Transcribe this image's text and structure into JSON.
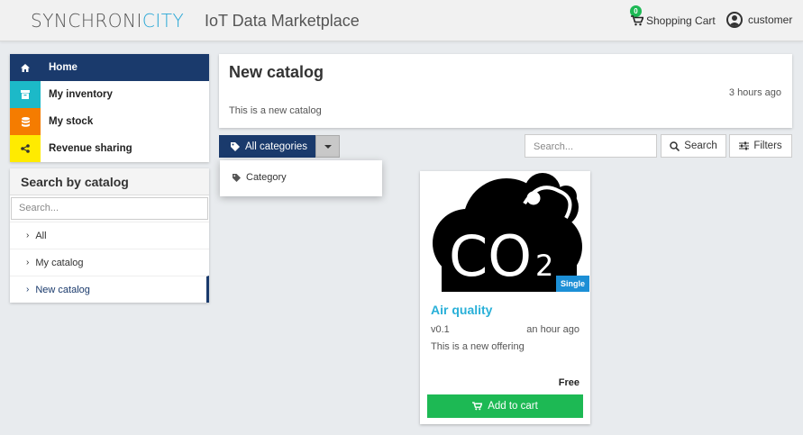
{
  "header": {
    "logo_part1": "SYNCHRONI",
    "logo_part2": "CITY",
    "app_title": "IoT Data Marketplace",
    "cart_badge": "0",
    "cart_label": "Shopping Cart",
    "user_label": "customer"
  },
  "nav": {
    "items": [
      {
        "label": "Home",
        "icon": "home-icon",
        "color": "#1a3a6c"
      },
      {
        "label": "My inventory",
        "icon": "archive-icon",
        "color": "#1cb9c8"
      },
      {
        "label": "My stock",
        "icon": "database-icon",
        "color": "#f57c00"
      },
      {
        "label": "Revenue sharing",
        "icon": "share-icon",
        "color": "#ffeb00"
      }
    ]
  },
  "catalog_search": {
    "title": "Search by catalog",
    "placeholder": "Search...",
    "items": [
      "All",
      "My catalog",
      "New catalog"
    ]
  },
  "catalog_panel": {
    "title": "New catalog",
    "time": "3 hours ago",
    "description": "This is a new catalog"
  },
  "toolbar": {
    "categories_label": "All categories",
    "dropdown_item": "Category",
    "search_placeholder": "Search...",
    "search_label": "Search",
    "filters_label": "Filters"
  },
  "offering": {
    "image_text": "CO",
    "image_subscript": "2",
    "badge": "Single",
    "title": "Air quality",
    "version": "v0.1",
    "time": "an hour ago",
    "description": "This is a new offering",
    "price": "Free",
    "add_label": "Add to cart"
  },
  "colors": {
    "primary": "#1a3a6c",
    "accent": "#29b0d8",
    "success": "#1db954"
  }
}
